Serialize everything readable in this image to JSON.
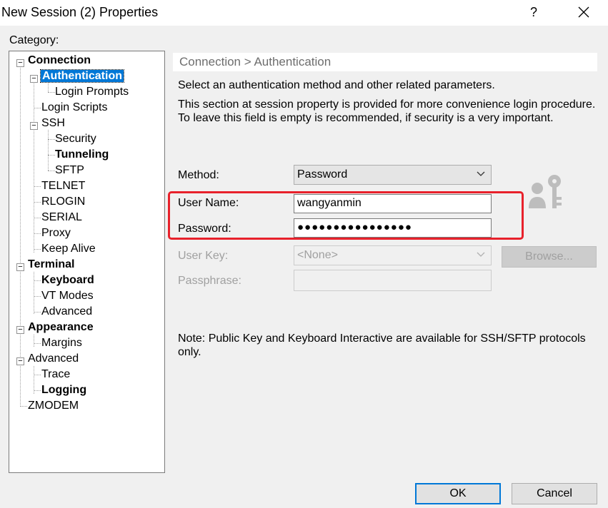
{
  "window": {
    "title": "New Session (2) Properties",
    "help_glyph": "?"
  },
  "sidebar": {
    "label": "Category:",
    "items": [
      {
        "label": "Connection"
      },
      {
        "label": "Authentication"
      },
      {
        "label": "Login Prompts"
      },
      {
        "label": "Login Scripts"
      },
      {
        "label": "SSH"
      },
      {
        "label": "Security"
      },
      {
        "label": "Tunneling"
      },
      {
        "label": "SFTP"
      },
      {
        "label": "TELNET"
      },
      {
        "label": "RLOGIN"
      },
      {
        "label": "SERIAL"
      },
      {
        "label": "Proxy"
      },
      {
        "label": "Keep Alive"
      },
      {
        "label": "Terminal"
      },
      {
        "label": "Keyboard"
      },
      {
        "label": "VT Modes"
      },
      {
        "label": "Advanced"
      },
      {
        "label": "Appearance"
      },
      {
        "label": "Margins"
      },
      {
        "label": "Advanced"
      },
      {
        "label": "Trace"
      },
      {
        "label": "Logging"
      },
      {
        "label": "ZMODEM"
      }
    ]
  },
  "main": {
    "breadcrumb": "Connection > Authentication",
    "intro": "Select an authentication method and other related parameters.",
    "description": "This section at session property is provided for more convenience login procedure. To leave this field is empty is recommended, if security is a very important.",
    "method": {
      "label": "Method:",
      "value": "Password"
    },
    "username": {
      "label": "User Name:",
      "value": "wangyanmin"
    },
    "password": {
      "label": "Password:",
      "value": "●●●●●●●●●●●●●●●●"
    },
    "userkey": {
      "label": "User Key:",
      "value": "<None>",
      "browse_label": "Browse..."
    },
    "passphrase": {
      "label": "Passphrase:",
      "value": ""
    },
    "note": "Note: Public Key and Keyboard Interactive are available for SSH/SFTP protocols only."
  },
  "footer": {
    "ok_label": "OK",
    "cancel_label": "Cancel"
  },
  "colors": {
    "highlight_border": "#e8212b",
    "selection": "#0078d7"
  },
  "icons": [
    "close-icon",
    "expand-collapse-icon",
    "chevron-down-icon",
    "user-key-icon"
  ]
}
